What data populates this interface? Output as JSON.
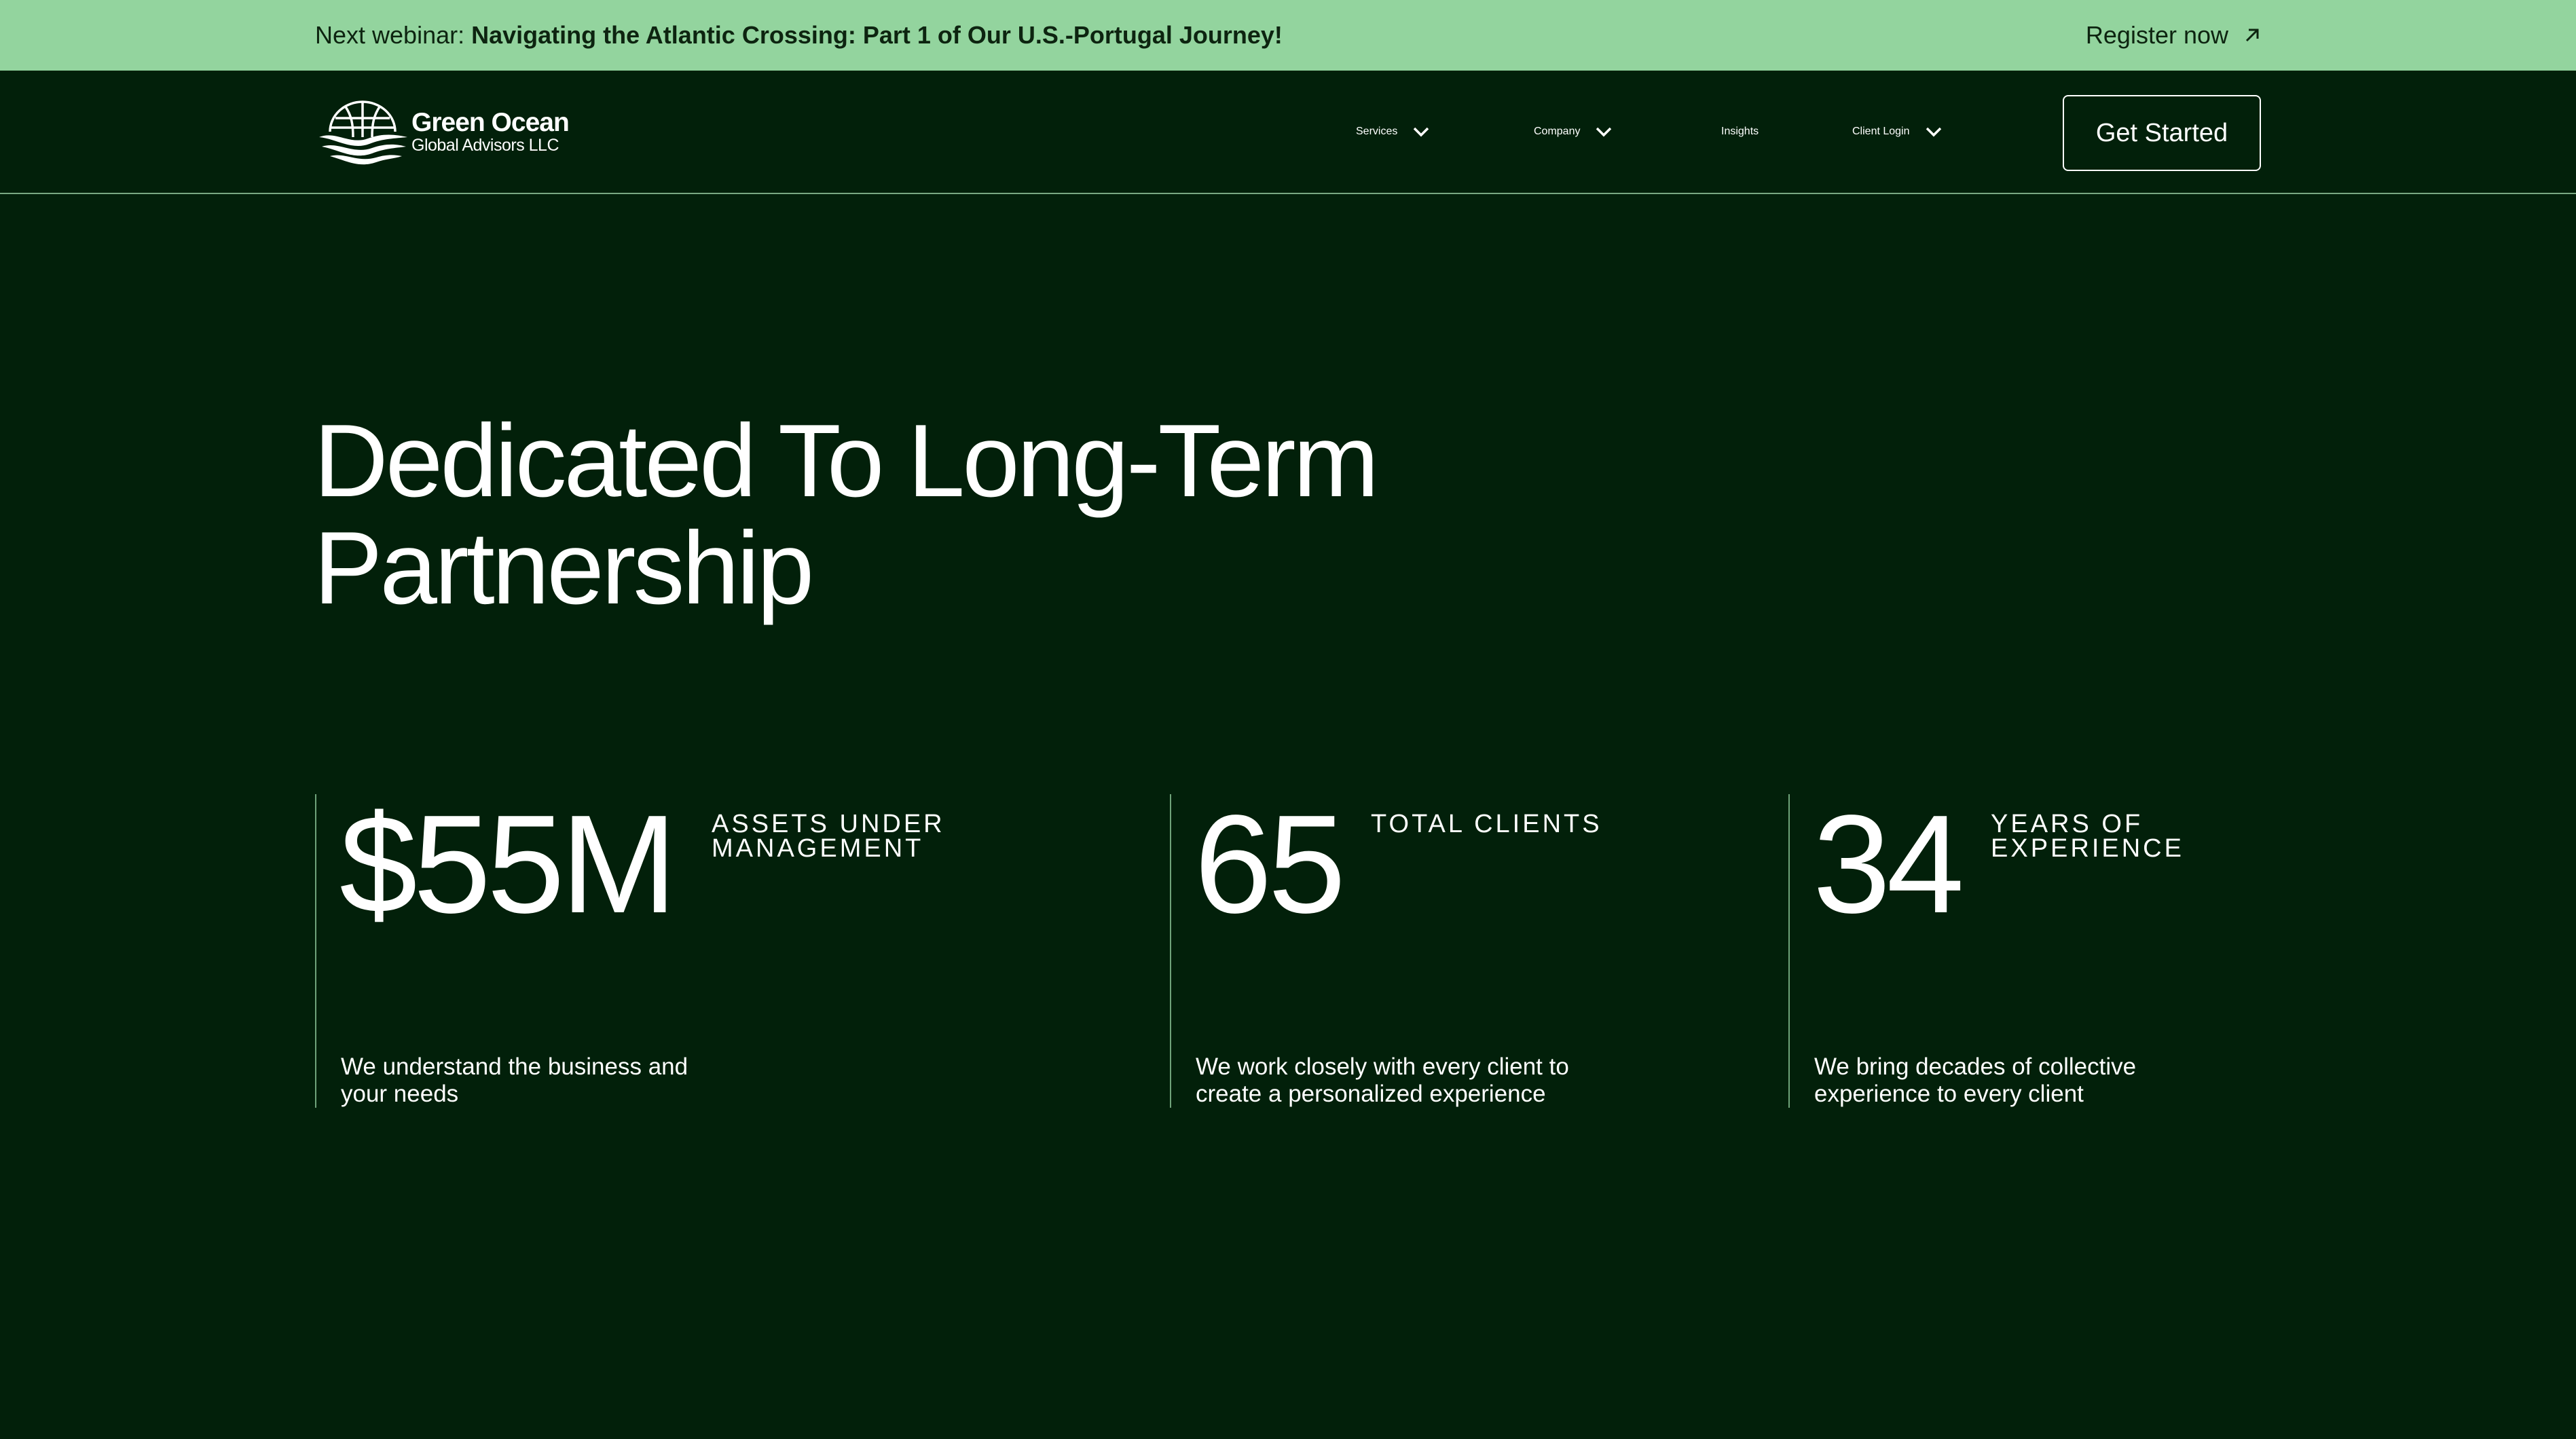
{
  "announcement": {
    "prefix": "Next webinar: ",
    "title": "Navigating the Atlantic Crossing: Part 1 of Our U.S.-Portugal Journey!",
    "register_label": "Register now"
  },
  "brand": {
    "name": "Green Ocean",
    "subtitle": "Global Advisors LLC"
  },
  "nav": {
    "items": [
      {
        "label": "Services",
        "has_dropdown": true
      },
      {
        "label": "Company",
        "has_dropdown": true
      },
      {
        "label": "Insights",
        "has_dropdown": false
      },
      {
        "label": "Client Login",
        "has_dropdown": true
      }
    ],
    "cta_label": "Get Started"
  },
  "hero": {
    "title_line1": "Dedicated To Long-Term",
    "title_line2": "Partnership"
  },
  "stats": [
    {
      "value": "$55M",
      "caption_line1": "ASSETS UNDER",
      "caption_line2": "MANAGEMENT",
      "desc_line1": "We understand the business and",
      "desc_line2": "your needs"
    },
    {
      "value": "65",
      "caption_line1": "TOTAL CLIENTS",
      "caption_line2": "",
      "desc_line1": "We work closely with every client to",
      "desc_line2": "create a personalized experience"
    },
    {
      "value": "34",
      "caption_line1": "YEARS OF",
      "caption_line2": "EXPERIENCE",
      "desc_line1": "We bring decades of collective",
      "desc_line2": "experience to every client"
    }
  ],
  "colors": {
    "background": "#02200a",
    "announcement_bg": "#93d49e",
    "text": "#ffffff",
    "divider": "#6fa37a"
  }
}
